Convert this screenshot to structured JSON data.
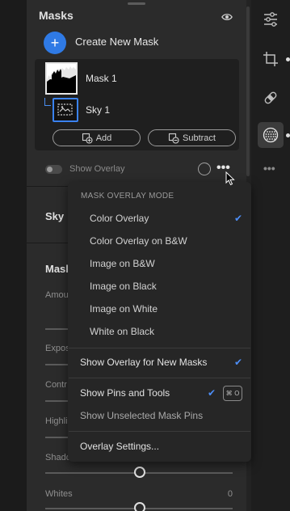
{
  "panel": {
    "title": "Masks",
    "create_label": "Create New Mask",
    "masks": [
      {
        "name": "Mask 1"
      },
      {
        "name": "Sky 1"
      }
    ],
    "add_label": "Add",
    "subtract_label": "Subtract",
    "show_overlay_label": "Show Overlay"
  },
  "sections": {
    "sky_label": "Sky",
    "mask_label_partial": "Mask",
    "sliders": [
      {
        "label": "Amou",
        "value": "",
        "position": 0.5
      },
      {
        "label": "Expos",
        "value": "",
        "position": 0.5
      },
      {
        "label": "Contr",
        "value": "",
        "position": 0.5
      },
      {
        "label": "Highli",
        "value": "",
        "position": 0.5
      },
      {
        "label": "Shado",
        "value": "",
        "position": 0.5
      },
      {
        "label": "Whites",
        "value": "0",
        "position": 0.5
      }
    ]
  },
  "menu": {
    "header": "MASK OVERLAY MODE",
    "modes": [
      {
        "label": "Color Overlay",
        "checked": true
      },
      {
        "label": "Color Overlay on B&W",
        "checked": false
      },
      {
        "label": "Image on B&W",
        "checked": false
      },
      {
        "label": "Image on Black",
        "checked": false
      },
      {
        "label": "Image on White",
        "checked": false
      },
      {
        "label": "White on Black",
        "checked": false
      }
    ],
    "show_overlay_new": "Show Overlay for New Masks",
    "show_pins": "Show Pins and Tools",
    "show_pins_shortcut": "⌘ O",
    "show_unselected": "Show Unselected Mask Pins",
    "overlay_settings": "Overlay Settings..."
  },
  "colors": {
    "accent": "#2f7ae5",
    "check": "#4d8ef7",
    "panel_bg": "#2b2b2b",
    "menu_bg": "#262626"
  },
  "tools": [
    "sliders-icon",
    "crop-icon",
    "healing-icon",
    "masking-icon",
    "more-icon"
  ]
}
